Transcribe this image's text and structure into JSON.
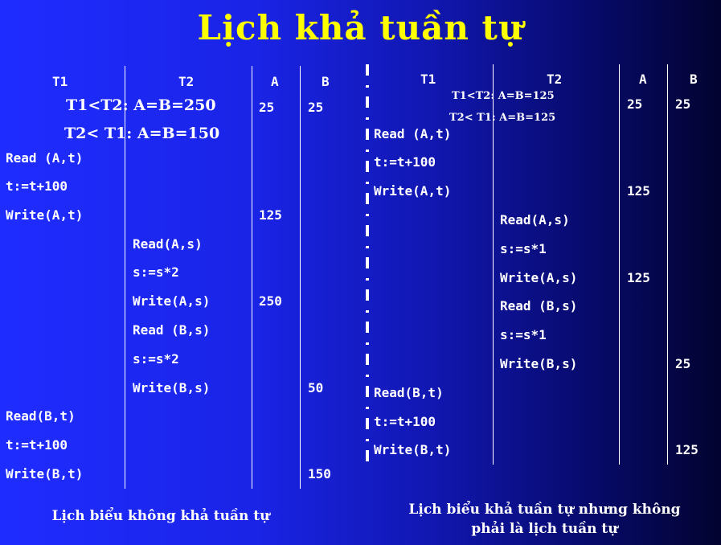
{
  "title": "Lịch khả tuần tự",
  "left": {
    "headers": [
      "T1",
      "T2",
      "A",
      "B"
    ],
    "note1": "T1<T2: A=B=250",
    "note2": "T2< T1: A=B=150",
    "initA": "25",
    "initB": "25",
    "t1_ops": [
      "Read (A,t)",
      "t:=t+100",
      "Write(A,t)",
      "Read(B,t)",
      "t:=t+100",
      "Write(B,t)"
    ],
    "t2_ops": [
      "Read(A,s)",
      "s:=s*2",
      "Write(A,s)",
      "Read (B,s)",
      "s:=s*2",
      "Write(B,s)"
    ],
    "vals": {
      "a1": "125",
      "a2": "250",
      "b1": "50",
      "b2": "150"
    },
    "caption": "Lịch biểu không khả tuần tự"
  },
  "right": {
    "headers": [
      "T1",
      "T2",
      "A",
      "B"
    ],
    "note1": "T1<T2: A=B=125",
    "note2": "T2< T1: A=B=125",
    "initA": "25",
    "initB": "25",
    "t1_ops": [
      "Read (A,t)",
      "t:=t+100",
      "Write(A,t)",
      "Read(B,t)",
      "t:=t+100",
      "Write(B,t)"
    ],
    "t2_ops": [
      "Read(A,s)",
      "s:=s*1",
      "Write(A,s)",
      "Read (B,s)",
      "s:=s*1",
      "Write(B,s)"
    ],
    "vals": {
      "a1": "125",
      "a2": "125",
      "b1": "25",
      "b2": "125"
    },
    "caption_line1": "Lịch biểu khả tuần tự nhưng không",
    "caption_line2": "phải là lịch tuần tự"
  }
}
